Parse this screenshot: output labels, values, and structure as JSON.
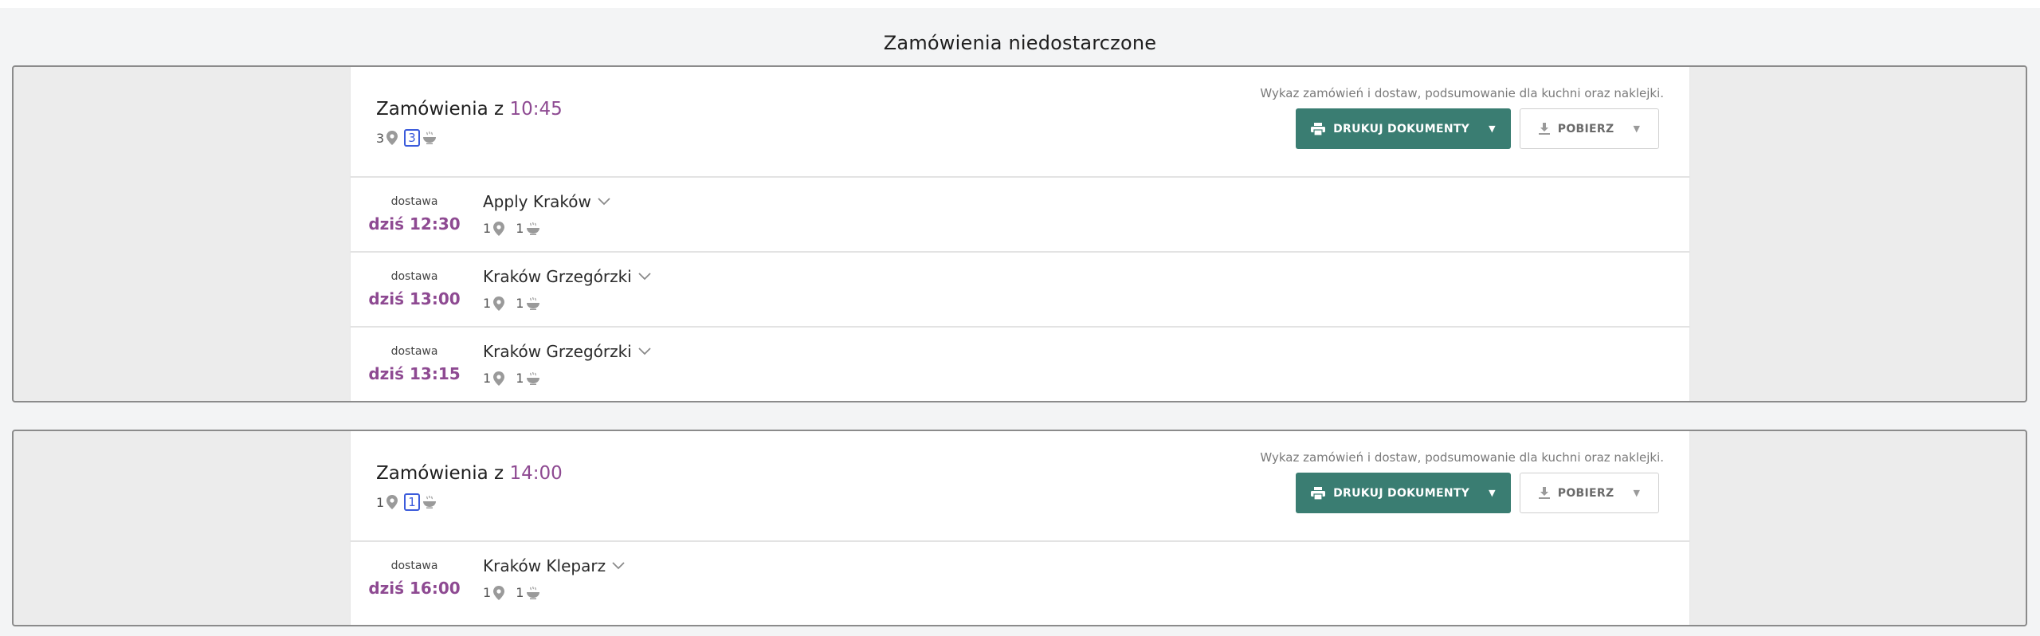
{
  "page": {
    "title": "Zamówienia niedostarczone"
  },
  "batches": [
    {
      "title_prefix": "Zamówienia z",
      "time": "10:45",
      "locations_count": "3",
      "meals_count": "3",
      "doc_description": "Wykaz zamówień i dostaw, podsumowanie dla kuchni oraz naklejki.",
      "print_label": "DRUKUJ DOKUMENTY",
      "download_label": "POBIERZ",
      "deliveries": [
        {
          "label": "dostawa",
          "time": "dziś 12:30",
          "name": "Apply Kraków",
          "locations": "1",
          "meals": "1"
        },
        {
          "label": "dostawa",
          "time": "dziś 13:00",
          "name": "Kraków Grzegórzki",
          "locations": "1",
          "meals": "1"
        },
        {
          "label": "dostawa",
          "time": "dziś 13:15",
          "name": "Kraków Grzegórzki",
          "locations": "1",
          "meals": "1"
        }
      ]
    },
    {
      "title_prefix": "Zamówienia z",
      "time": "14:00",
      "locations_count": "1",
      "meals_count": "1",
      "doc_description": "Wykaz zamówień i dostaw, podsumowanie dla kuchni oraz naklejki.",
      "print_label": "DRUKUJ DOKUMENTY",
      "download_label": "POBIERZ",
      "deliveries": [
        {
          "label": "dostawa",
          "time": "dziś 16:00",
          "name": "Kraków Kleparz",
          "locations": "1",
          "meals": "1"
        }
      ]
    }
  ],
  "icons": {
    "location": "location-pin-icon",
    "meal": "meal-bowl-icon",
    "print": "printer-icon",
    "download": "download-icon",
    "chevron": "chevron-down-icon"
  },
  "colors": {
    "accent_time": "#8e4a92",
    "primary_button": "#3a7d72",
    "group_border": "#8b8b8b",
    "focus_outline": "#3b5bdb"
  }
}
